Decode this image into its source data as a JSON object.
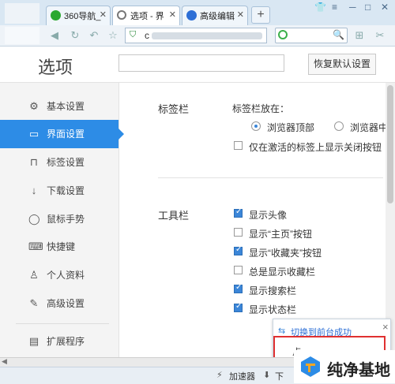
{
  "browser": {
    "tabs": [
      {
        "label": "360导航_",
        "icon": "360-logo-icon",
        "color": "#2aa830",
        "active": false
      },
      {
        "label": "选项 - 界",
        "icon": "gear-icon",
        "color": "#666666",
        "active": true
      },
      {
        "label": "高级编辑",
        "icon": "paw-icon",
        "color": "#2d6fd6",
        "active": false
      }
    ],
    "new_tab": "+",
    "address_prefix": "c",
    "window_buttons": [
      "─",
      "□",
      "✕"
    ]
  },
  "page": {
    "title": "选项",
    "reset_button": "恢复默认设置"
  },
  "sidebar": {
    "items": [
      {
        "label": "基本设置",
        "icon": "gear-icon",
        "glyph": "⚙",
        "active": false
      },
      {
        "label": "界面设置",
        "icon": "window-icon",
        "glyph": "▭",
        "active": true
      },
      {
        "label": "标签设置",
        "icon": "tab-icon",
        "glyph": "⊓",
        "active": false
      },
      {
        "label": "下载设置",
        "icon": "download-icon",
        "glyph": "↓",
        "active": false
      },
      {
        "label": "鼠标手势",
        "icon": "mouse-icon",
        "glyph": "◯",
        "active": false
      },
      {
        "label": "快捷键",
        "icon": "keyboard-icon",
        "glyph": "⌨",
        "active": false
      },
      {
        "label": "个人资料",
        "icon": "person-icon",
        "glyph": "♙",
        "active": false
      },
      {
        "label": "高级设置",
        "icon": "wrench-icon",
        "glyph": "✎",
        "active": false
      },
      {
        "label": "扩展程序",
        "icon": "extension-icon",
        "glyph": "▤",
        "active": false
      }
    ]
  },
  "tabbar_section": {
    "title": "标签栏",
    "position_label": "标签栏放在：",
    "radio_top": "浏览器顶部",
    "radio_middle": "浏览器中",
    "checkbox_close": "仅在激活的标签上显示关闭按钮"
  },
  "toolbar_section": {
    "title": "工具栏",
    "options": [
      {
        "label": "显示头像",
        "checked": true
      },
      {
        "label": "显示“主页”按钮",
        "checked": false
      },
      {
        "label": "显示“收藏夹”按钮",
        "checked": true
      },
      {
        "label": "总是显示收藏栏",
        "checked": false
      },
      {
        "label": "显示搜索栏",
        "checked": true
      },
      {
        "label": "显示状态栏",
        "checked": true
      }
    ]
  },
  "popup": {
    "text": "切换到前台成功",
    "close": "×",
    "partial": "卢"
  },
  "status": {
    "accelerator": "加速器",
    "download": "下"
  },
  "watermark": {
    "text": "纯净基地"
  },
  "colors": {
    "accent": "#2d8ce6",
    "popup_highlight": "#e03030"
  }
}
